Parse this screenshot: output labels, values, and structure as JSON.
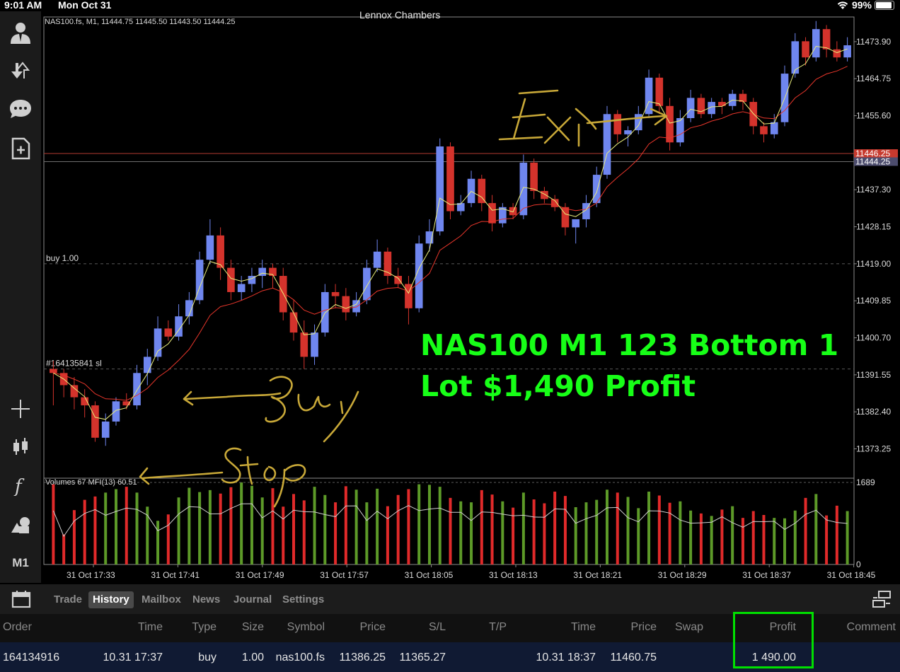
{
  "status_bar": {
    "time": "9:01 AM",
    "date": "Mon Oct 31",
    "battery": "99%"
  },
  "chart": {
    "account_name": "Lennox Chambers",
    "symbol_info": "NAS100.fs, M1, 11444.75 11445.50 11443.50 11444.25",
    "price_labels": [
      "11473.90",
      "11464.75",
      "11455.60",
      "11437.30",
      "11428.15",
      "11419.00",
      "11409.85",
      "11400.70",
      "11391.55",
      "11382.40",
      "11373.25"
    ],
    "ask_price": "11446.25",
    "bid_price": "11444.25",
    "buy_label": "buy 1.00",
    "sl_label": "#164135841 sl",
    "indicator_label": "Volumes 67 MFI(13) 60.51",
    "volume_max": "1689",
    "volume_min": "0",
    "time_labels": [
      "31 Oct 17:33",
      "31 Oct 17:41",
      "31 Oct 17:49",
      "31 Oct 17:57",
      "31 Oct 18:05",
      "31 Oct 18:13",
      "31 Oct 18:21",
      "31 Oct 18:29",
      "31 Oct 18:37",
      "31 Oct 18:45"
    ],
    "candle_colors": {
      "bull": "#6f86ef",
      "bear": "#d4332c",
      "vol_up": "#5d9a28",
      "vol_down": "#e12a2a"
    }
  },
  "chart_data": {
    "type": "candlestick",
    "symbol": "NAS100.fs",
    "timeframe": "M1",
    "y_range": [
      11366,
      11480
    ],
    "candles": [
      [
        11393,
        11395,
        11384,
        11392
      ],
      [
        11392,
        11393,
        11386,
        11389
      ],
      [
        11389,
        11391,
        11383,
        11386
      ],
      [
        11386,
        11388,
        11381,
        11384
      ],
      [
        11384,
        11385,
        11375,
        11376
      ],
      [
        11376,
        11382,
        11374,
        11380
      ],
      [
        11380,
        11386,
        11379,
        11385
      ],
      [
        11385,
        11387,
        11383,
        11384
      ],
      [
        11384,
        11394,
        11383,
        11392
      ],
      [
        11392,
        11398,
        11389,
        11396
      ],
      [
        11396,
        11406,
        11395,
        11403
      ],
      [
        11403,
        11405,
        11400,
        11401
      ],
      [
        11401,
        11409,
        11400,
        11406
      ],
      [
        11406,
        11412,
        11404,
        11410
      ],
      [
        11410,
        11422,
        11409,
        11420
      ],
      [
        11420,
        11430,
        11419,
        11426
      ],
      [
        11426,
        11428,
        11415,
        11418
      ],
      [
        11418,
        11420,
        11410,
        11412
      ],
      [
        11412,
        11416,
        11410,
        11414
      ],
      [
        11414,
        11418,
        11412,
        11416
      ],
      [
        11416,
        11420,
        11413,
        11418
      ],
      [
        11418,
        11419,
        11413,
        11416
      ],
      [
        11416,
        11418,
        11405,
        11407
      ],
      [
        11407,
        11410,
        11400,
        11402
      ],
      [
        11402,
        11405,
        11393,
        11396
      ],
      [
        11396,
        11404,
        11394,
        11402
      ],
      [
        11402,
        11414,
        11401,
        11412
      ],
      [
        11412,
        11414,
        11408,
        11411
      ],
      [
        11411,
        11413,
        11405,
        11407
      ],
      [
        11407,
        11412,
        11406,
        11410
      ],
      [
        11410,
        11420,
        11409,
        11418
      ],
      [
        11418,
        11425,
        11417,
        11422
      ],
      [
        11422,
        11423,
        11414,
        11416
      ],
      [
        11416,
        11418,
        11413,
        11414
      ],
      [
        11414,
        11416,
        11404,
        11408
      ],
      [
        11408,
        11426,
        11407,
        11424
      ],
      [
        11424,
        11430,
        11422,
        11427
      ],
      [
        11427,
        11450,
        11426,
        11448
      ],
      [
        11448,
        11449,
        11430,
        11432
      ],
      [
        11432,
        11436,
        11431,
        11434
      ],
      [
        11434,
        11442,
        11433,
        11440
      ],
      [
        11440,
        11441,
        11432,
        11434
      ],
      [
        11434,
        11436,
        11427,
        11429
      ],
      [
        11429,
        11434,
        11428,
        11433
      ],
      [
        11433,
        11434,
        11430,
        11431
      ],
      [
        11431,
        11446,
        11430,
        11444
      ],
      [
        11444,
        11445,
        11435,
        11437
      ],
      [
        11437,
        11438,
        11434,
        11435
      ],
      [
        11435,
        11436,
        11432,
        11433
      ],
      [
        11433,
        11434,
        11426,
        11428
      ],
      [
        11428,
        11430,
        11424,
        11430
      ],
      [
        11430,
        11436,
        11428,
        11434
      ],
      [
        11434,
        11443,
        11433,
        11441
      ],
      [
        11441,
        11458,
        11440,
        11456
      ],
      [
        11456,
        11457,
        11449,
        11451
      ],
      [
        11451,
        11453,
        11448,
        11452
      ],
      [
        11452,
        11458,
        11451,
        11456
      ],
      [
        11456,
        11467,
        11455,
        11465
      ],
      [
        11465,
        11466,
        11456,
        11458
      ],
      [
        11458,
        11460,
        11447,
        11449
      ],
      [
        11449,
        11457,
        11448,
        11455
      ],
      [
        11455,
        11462,
        11454,
        11460
      ],
      [
        11460,
        11461,
        11455,
        11456
      ],
      [
        11456,
        11460,
        11455,
        11459
      ],
      [
        11459,
        11460,
        11456,
        11458
      ],
      [
        11458,
        11462,
        11457,
        11461
      ],
      [
        11461,
        11462,
        11457,
        11459
      ],
      [
        11459,
        11460,
        11451,
        11453
      ],
      [
        11453,
        11454,
        11449,
        11451
      ],
      [
        11451,
        11456,
        11450,
        11454
      ],
      [
        11454,
        11468,
        11453,
        11466
      ],
      [
        11466,
        11476,
        11465,
        11474
      ],
      [
        11474,
        11475,
        11468,
        11470
      ],
      [
        11470,
        11479,
        11469,
        11477
      ],
      [
        11477,
        11478,
        11470,
        11472
      ],
      [
        11472,
        11474,
        11469,
        11470
      ],
      [
        11470,
        11475,
        11469,
        11473
      ]
    ],
    "volumes": [
      1650,
      620,
      1120,
      1330,
      1400,
      1480,
      1550,
      1600,
      1480,
      1190,
      900,
      1030,
      1380,
      1580,
      1490,
      1530,
      1460,
      1590,
      1690,
      1620,
      1380,
      1570,
      1190,
      1450,
      1320,
      1600,
      1430,
      1280,
      1610,
      1540,
      1280,
      1560,
      1200,
      1430,
      1550,
      1650,
      1640,
      1600,
      1370,
      1300,
      1280,
      1530,
      1440,
      1300,
      1170,
      1480,
      1340,
      1260,
      1500,
      1410,
      1180,
      1280,
      1330,
      1540,
      1480,
      1390,
      1160,
      1500,
      1420,
      1270,
      1300,
      1110,
      1050,
      1000,
      1130,
      1200,
      960,
      1100,
      1020,
      960,
      950,
      1110,
      1370,
      1450,
      1010,
      1210,
      1100
    ],
    "ask": 11446.25,
    "bid": 11444.25,
    "buy_level": 11419.0,
    "sl_level": 11393.0,
    "volume_ylim": [
      0,
      1689
    ]
  },
  "annotations": {
    "headline_line1": "NAS100 M1 123 Bottom 1",
    "headline_line2": "Lot $1,490 Profit",
    "handwritten_exit": "Exit",
    "handwritten_buy": "Buy",
    "handwritten_stop": "Stop"
  },
  "sidebar": {
    "timeframe_label": "M1"
  },
  "tabs": [
    {
      "label": "Trade",
      "active": false
    },
    {
      "label": "History",
      "active": true
    },
    {
      "label": "Mailbox",
      "active": false
    },
    {
      "label": "News",
      "active": false
    },
    {
      "label": "Journal",
      "active": false
    },
    {
      "label": "Settings",
      "active": false
    }
  ],
  "history_table": {
    "columns": [
      "Order",
      "Time",
      "Type",
      "Size",
      "Symbol",
      "Price",
      "S/L",
      "T/P",
      "Time",
      "Price",
      "Swap",
      "Profit",
      "Comment"
    ],
    "rows": [
      {
        "order": "164134916",
        "open_time": "10.31 17:37",
        "type": "buy",
        "size": "1.00",
        "symbol": "nas100.fs",
        "open_price": "11386.25",
        "sl": "11365.27",
        "tp": "",
        "close_time": "10.31 18:37",
        "close_price": "11460.75",
        "swap": "",
        "profit": "1 490.00",
        "comment": ""
      }
    ]
  }
}
